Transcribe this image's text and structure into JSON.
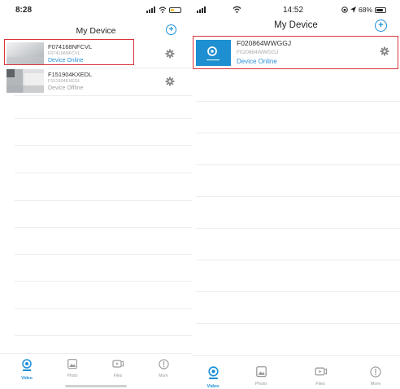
{
  "left": {
    "status": {
      "time": "8:28"
    },
    "title": "My Device",
    "add_symbol": "+",
    "devices": [
      {
        "name": "F074168NFCVL",
        "id": "F074168NFCVL",
        "status": "Device Online"
      },
      {
        "name": "F151904KXEDL",
        "id": "F151904KXEDL",
        "status": "Device Offline"
      }
    ],
    "tabs": [
      "Video",
      "Photo",
      "Files",
      "More"
    ]
  },
  "right": {
    "status": {
      "time": "14:52",
      "battery": "68%"
    },
    "title": "My Device",
    "add_symbol": "+",
    "devices": [
      {
        "name": "F020864WWGGJ",
        "id": "F020864WWGGJ",
        "status": "Device Online"
      }
    ],
    "tabs": [
      "Video",
      "Photo",
      "Files",
      "More"
    ]
  },
  "colors": {
    "accent": "#1a8fd8",
    "online": "#2a8fd6",
    "offline": "#a0a0a0",
    "highlight": "#d9343a",
    "tab_inactive": "#9a9a9a",
    "thumb_blue": "#1e8fd0"
  },
  "icons": {
    "add": "plus-circle-icon",
    "settings": "gear-icon",
    "video": "camera-pin-icon",
    "photo": "photo-icon",
    "files": "video-file-icon",
    "more": "info-circle-icon"
  }
}
